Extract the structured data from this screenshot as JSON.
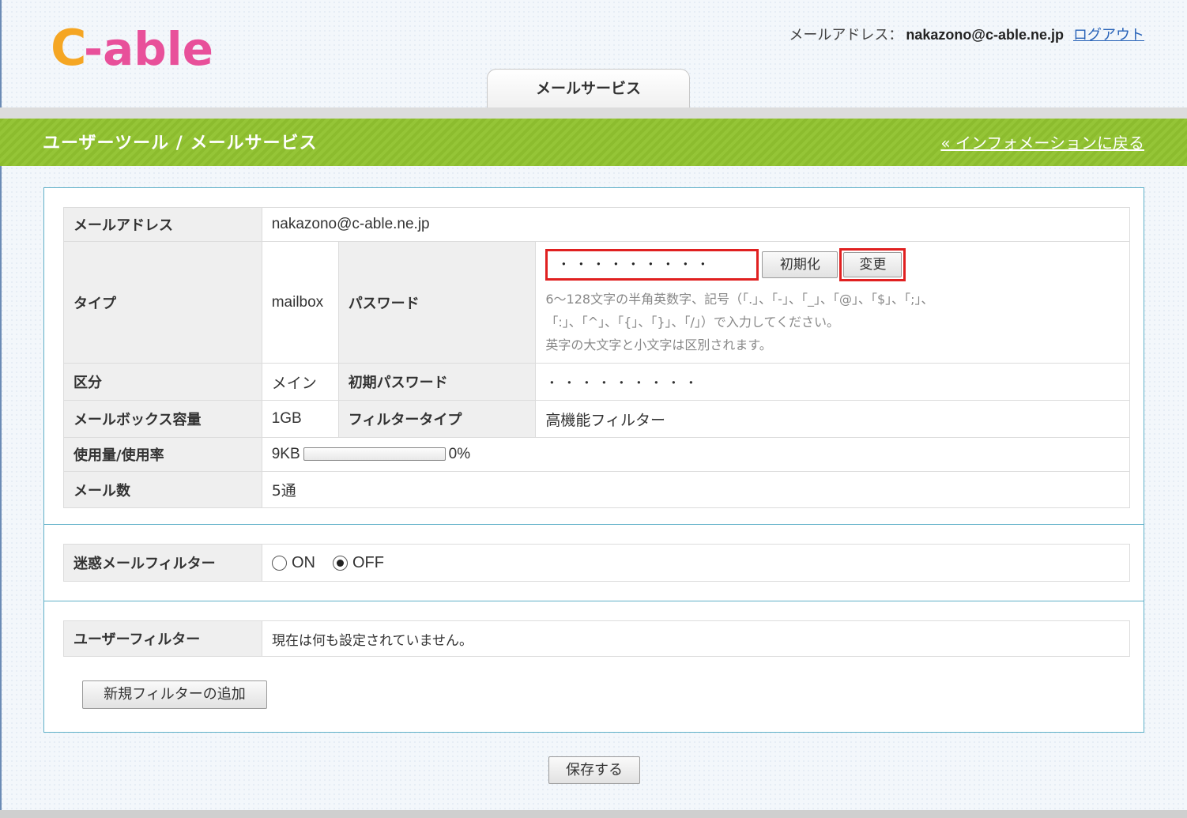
{
  "header": {
    "logo_text": "C-able",
    "email_label": "メールアドレス：",
    "email_value": "nakazono@c-able.ne.jp",
    "logout_label": "ログアウト",
    "tab_label": "メールサービス"
  },
  "banner": {
    "title": "ユーザーツール / メールサービス",
    "back_link": "« インフォメーションに戻る"
  },
  "account": {
    "email": {
      "label": "メールアドレス",
      "value": "nakazono@c-able.ne.jp"
    },
    "type": {
      "label": "タイプ",
      "value": "mailbox"
    },
    "password": {
      "label": "パスワード",
      "value": "・・・・・・・・・",
      "reset_label": "初期化",
      "change_label": "変更",
      "hint_line1": "6～128文字の半角英数字、記号（「.」、「-」、「_」、「@」、「$」、「;」、",
      "hint_line2": "「:」、「^」、「{」、「}」、「/」）で入力してください。",
      "hint_line3": "英字の大文字と小文字は区別されます。"
    },
    "category": {
      "label": "区分",
      "value": "メイン"
    },
    "initial_password": {
      "label": "初期パスワード",
      "value": "・・・・・・・・・"
    },
    "capacity": {
      "label": "メールボックス容量",
      "value": "1GB"
    },
    "filter_type": {
      "label": "フィルタータイプ",
      "value": "高機能フィルター"
    },
    "usage": {
      "label": "使用量/使用率",
      "amount": "9KB",
      "percent": "0%",
      "fraction": 0
    },
    "mail_count": {
      "label": "メール数",
      "value": "5通"
    }
  },
  "spam_filter": {
    "label": "迷惑メールフィルター",
    "on_label": "ON",
    "off_label": "OFF",
    "selected": "OFF"
  },
  "user_filter": {
    "label": "ユーザーフィルター",
    "value": "現在は何も設定されていません。",
    "add_button": "新規フィルターの追加"
  },
  "save_button": "保存する",
  "colors": {
    "brand_orange": "#f5a623",
    "brand_pink": "#e8509a",
    "banner_green": "#8cbc2e",
    "highlight_red": "#e02020",
    "link_blue": "#2a64b8"
  }
}
